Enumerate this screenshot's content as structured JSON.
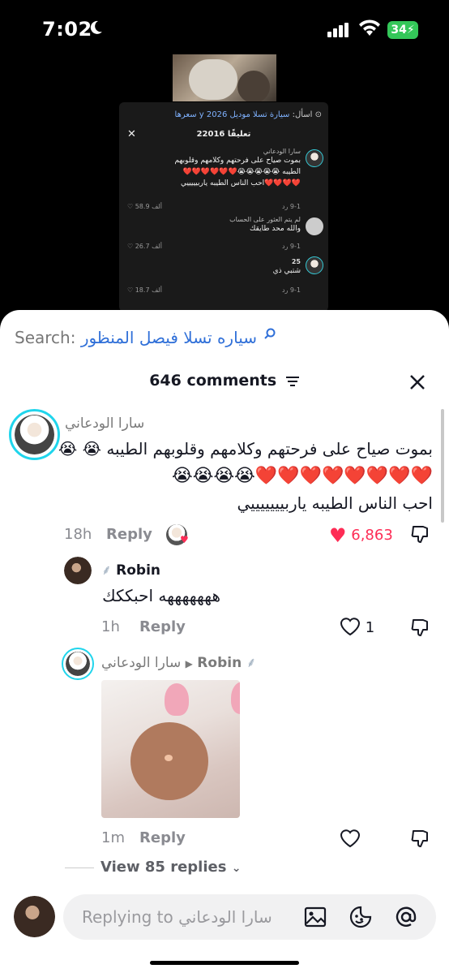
{
  "status_bar": {
    "time": "7:02",
    "battery": "34"
  },
  "mini_panel": {
    "search_prefix": "اسأل:",
    "search_query": "سيارة تسلا موديل 2026 y سعرها",
    "comment_count": "22016 تعليقًا",
    "c1_name": "سارا الودعاني",
    "c1_text_1": "بموت صياح على فرحتهم وكلامهم وقلوبهم",
    "c1_text_2": "الطيبه 😭😭😭😭😭❤️❤️❤️❤️❤️❤️",
    "c1_text_3": "❤️❤️❤️❤️احب الناس الطيبه ياربيييييي",
    "c1_meta": "9-1   رد",
    "c1_likes": "58.9 ألف",
    "c2_name": "لم يتم العثور على الحساب",
    "c2_text": "والله محد طايقك",
    "c2_meta": "9-1   رد",
    "c2_likes": "26.7 ألف",
    "c3_name": "25",
    "c3_text": "شتبي ذي",
    "c3_meta": "9-1   رد",
    "c3_likes": "18.7 ألف"
  },
  "search": {
    "label": "Search:",
    "query": "سياره تسلا فيصل المنظور"
  },
  "header": {
    "count": "646 comments"
  },
  "comments": {
    "main": {
      "author": "سارا الودعاني",
      "line1": "بموت صياح على فرحتهم وكلامهم وقلوبهم الطيبه 😭 😭",
      "line2": "❤️❤️❤️❤️❤️❤️❤️❤️😭😭😭😭",
      "line3": "احب الناس الطيبه ياربيييييييي",
      "time": "18h",
      "reply_label": "Reply",
      "likes": "6,863"
    },
    "reply1": {
      "author": "Robin",
      "text": "هههههههه احبككك",
      "time": "1h",
      "reply_label": "Reply",
      "likes": "1"
    },
    "reply2": {
      "author": "سارا الودعاني",
      "to": "Robin",
      "time": "1m",
      "reply_label": "Reply"
    }
  },
  "view_more": "View 85 replies",
  "input": {
    "placeholder": "Replying to سارا الودعاني"
  },
  "colors": {
    "accent_red": "#fe2c55",
    "ring": "#20d5ec",
    "link_blue": "#2f6fd8"
  }
}
